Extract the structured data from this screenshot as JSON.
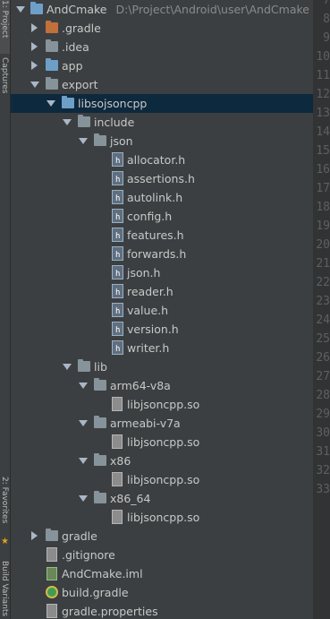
{
  "left_strip": {
    "tabs": [
      {
        "label": "1: Project"
      },
      {
        "label": "Captures"
      },
      {
        "label": "2: Favorites"
      },
      {
        "label": "Build Variants"
      }
    ]
  },
  "tree": {
    "root": {
      "label": "AndCmake",
      "path": "D:\\Project\\Android\\user\\AndCmake"
    },
    "items": [
      {
        "label": ".gradle"
      },
      {
        "label": ".idea"
      },
      {
        "label": "app"
      },
      {
        "label": "export"
      },
      {
        "label": "libsojsoncpp"
      },
      {
        "label": "include"
      },
      {
        "label": "json"
      },
      {
        "label": "allocator.h"
      },
      {
        "label": "assertions.h"
      },
      {
        "label": "autolink.h"
      },
      {
        "label": "config.h"
      },
      {
        "label": "features.h"
      },
      {
        "label": "forwards.h"
      },
      {
        "label": "json.h"
      },
      {
        "label": "reader.h"
      },
      {
        "label": "value.h"
      },
      {
        "label": "version.h"
      },
      {
        "label": "writer.h"
      },
      {
        "label": "lib"
      },
      {
        "label": "arm64-v8a"
      },
      {
        "label": "libjsoncpp.so"
      },
      {
        "label": "armeabi-v7a"
      },
      {
        "label": "libjsoncpp.so"
      },
      {
        "label": "x86"
      },
      {
        "label": "libjsoncpp.so"
      },
      {
        "label": "x86_64"
      },
      {
        "label": "libjsoncpp.so"
      },
      {
        "label": "gradle"
      },
      {
        "label": ".gitignore"
      },
      {
        "label": "AndCmake.iml"
      },
      {
        "label": "build.gradle"
      },
      {
        "label": "gradle.properties"
      }
    ]
  },
  "gutter": {
    "line_numbers": [
      "7",
      "8",
      "9",
      "10",
      "11",
      "12",
      "13",
      "14",
      "15",
      "16",
      "17",
      "18",
      "19",
      "20",
      "21",
      "22",
      "23",
      "24",
      "25",
      "26",
      "27",
      "28",
      "29",
      "30",
      "31",
      "32",
      "33"
    ]
  }
}
